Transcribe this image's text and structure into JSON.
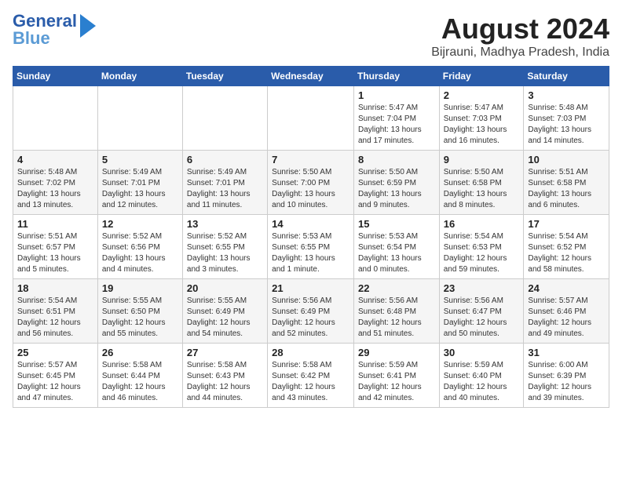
{
  "logo": {
    "line1": "General",
    "line2": "Blue"
  },
  "title": "August 2024",
  "subtitle": "Bijrauni, Madhya Pradesh, India",
  "days_of_week": [
    "Sunday",
    "Monday",
    "Tuesday",
    "Wednesday",
    "Thursday",
    "Friday",
    "Saturday"
  ],
  "weeks": [
    [
      {
        "day": "",
        "info": ""
      },
      {
        "day": "",
        "info": ""
      },
      {
        "day": "",
        "info": ""
      },
      {
        "day": "",
        "info": ""
      },
      {
        "day": "1",
        "info": "Sunrise: 5:47 AM\nSunset: 7:04 PM\nDaylight: 13 hours and 17 minutes."
      },
      {
        "day": "2",
        "info": "Sunrise: 5:47 AM\nSunset: 7:03 PM\nDaylight: 13 hours and 16 minutes."
      },
      {
        "day": "3",
        "info": "Sunrise: 5:48 AM\nSunset: 7:03 PM\nDaylight: 13 hours and 14 minutes."
      }
    ],
    [
      {
        "day": "4",
        "info": "Sunrise: 5:48 AM\nSunset: 7:02 PM\nDaylight: 13 hours and 13 minutes."
      },
      {
        "day": "5",
        "info": "Sunrise: 5:49 AM\nSunset: 7:01 PM\nDaylight: 13 hours and 12 minutes."
      },
      {
        "day": "6",
        "info": "Sunrise: 5:49 AM\nSunset: 7:01 PM\nDaylight: 13 hours and 11 minutes."
      },
      {
        "day": "7",
        "info": "Sunrise: 5:50 AM\nSunset: 7:00 PM\nDaylight: 13 hours and 10 minutes."
      },
      {
        "day": "8",
        "info": "Sunrise: 5:50 AM\nSunset: 6:59 PM\nDaylight: 13 hours and 9 minutes."
      },
      {
        "day": "9",
        "info": "Sunrise: 5:50 AM\nSunset: 6:58 PM\nDaylight: 13 hours and 8 minutes."
      },
      {
        "day": "10",
        "info": "Sunrise: 5:51 AM\nSunset: 6:58 PM\nDaylight: 13 hours and 6 minutes."
      }
    ],
    [
      {
        "day": "11",
        "info": "Sunrise: 5:51 AM\nSunset: 6:57 PM\nDaylight: 13 hours and 5 minutes."
      },
      {
        "day": "12",
        "info": "Sunrise: 5:52 AM\nSunset: 6:56 PM\nDaylight: 13 hours and 4 minutes."
      },
      {
        "day": "13",
        "info": "Sunrise: 5:52 AM\nSunset: 6:55 PM\nDaylight: 13 hours and 3 minutes."
      },
      {
        "day": "14",
        "info": "Sunrise: 5:53 AM\nSunset: 6:55 PM\nDaylight: 13 hours and 1 minute."
      },
      {
        "day": "15",
        "info": "Sunrise: 5:53 AM\nSunset: 6:54 PM\nDaylight: 13 hours and 0 minutes."
      },
      {
        "day": "16",
        "info": "Sunrise: 5:54 AM\nSunset: 6:53 PM\nDaylight: 12 hours and 59 minutes."
      },
      {
        "day": "17",
        "info": "Sunrise: 5:54 AM\nSunset: 6:52 PM\nDaylight: 12 hours and 58 minutes."
      }
    ],
    [
      {
        "day": "18",
        "info": "Sunrise: 5:54 AM\nSunset: 6:51 PM\nDaylight: 12 hours and 56 minutes."
      },
      {
        "day": "19",
        "info": "Sunrise: 5:55 AM\nSunset: 6:50 PM\nDaylight: 12 hours and 55 minutes."
      },
      {
        "day": "20",
        "info": "Sunrise: 5:55 AM\nSunset: 6:49 PM\nDaylight: 12 hours and 54 minutes."
      },
      {
        "day": "21",
        "info": "Sunrise: 5:56 AM\nSunset: 6:49 PM\nDaylight: 12 hours and 52 minutes."
      },
      {
        "day": "22",
        "info": "Sunrise: 5:56 AM\nSunset: 6:48 PM\nDaylight: 12 hours and 51 minutes."
      },
      {
        "day": "23",
        "info": "Sunrise: 5:56 AM\nSunset: 6:47 PM\nDaylight: 12 hours and 50 minutes."
      },
      {
        "day": "24",
        "info": "Sunrise: 5:57 AM\nSunset: 6:46 PM\nDaylight: 12 hours and 49 minutes."
      }
    ],
    [
      {
        "day": "25",
        "info": "Sunrise: 5:57 AM\nSunset: 6:45 PM\nDaylight: 12 hours and 47 minutes."
      },
      {
        "day": "26",
        "info": "Sunrise: 5:58 AM\nSunset: 6:44 PM\nDaylight: 12 hours and 46 minutes."
      },
      {
        "day": "27",
        "info": "Sunrise: 5:58 AM\nSunset: 6:43 PM\nDaylight: 12 hours and 44 minutes."
      },
      {
        "day": "28",
        "info": "Sunrise: 5:58 AM\nSunset: 6:42 PM\nDaylight: 12 hours and 43 minutes."
      },
      {
        "day": "29",
        "info": "Sunrise: 5:59 AM\nSunset: 6:41 PM\nDaylight: 12 hours and 42 minutes."
      },
      {
        "day": "30",
        "info": "Sunrise: 5:59 AM\nSunset: 6:40 PM\nDaylight: 12 hours and 40 minutes."
      },
      {
        "day": "31",
        "info": "Sunrise: 6:00 AM\nSunset: 6:39 PM\nDaylight: 12 hours and 39 minutes."
      }
    ]
  ]
}
